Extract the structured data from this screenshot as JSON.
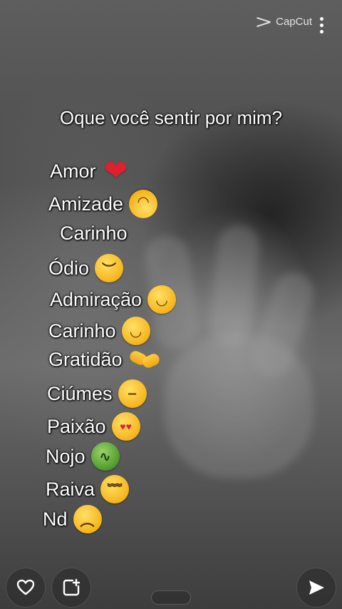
{
  "watermark": {
    "label": "CapCut"
  },
  "heading": "Oque você sentir por mim?",
  "items": [
    {
      "label": "Amor",
      "emoji": "red-heart",
      "glyph": "❤"
    },
    {
      "label": "Amizade",
      "emoji": "upside-down-face",
      "glyph": "◡"
    },
    {
      "label": "Carinho",
      "emoji": "",
      "glyph": ""
    },
    {
      "label": "Ódio",
      "emoji": "angry-face",
      "glyph": "︶"
    },
    {
      "label": "Admiração",
      "emoji": "smiling-face",
      "glyph": "◡"
    },
    {
      "label": "Carinho",
      "emoji": "relieved-face",
      "glyph": "◡"
    },
    {
      "label": "Gratidão",
      "emoji": "handshake",
      "glyph": ""
    },
    {
      "label": "Ciúmes",
      "emoji": "unamused-face",
      "glyph": "‒"
    },
    {
      "label": "Paixão",
      "emoji": "heart-eyes-face",
      "glyph": "♥♥"
    },
    {
      "label": "Nojo",
      "emoji": "nauseated-face",
      "glyph": "∿"
    },
    {
      "label": "Raiva",
      "emoji": "steam-face",
      "glyph": "﹌"
    },
    {
      "label": "Nd",
      "emoji": "slightly-frowning-face",
      "glyph": "︵"
    }
  ],
  "controls": {
    "like": "heart-outline-icon",
    "add": "add-to-story-icon",
    "send": "send-arrow-icon"
  }
}
